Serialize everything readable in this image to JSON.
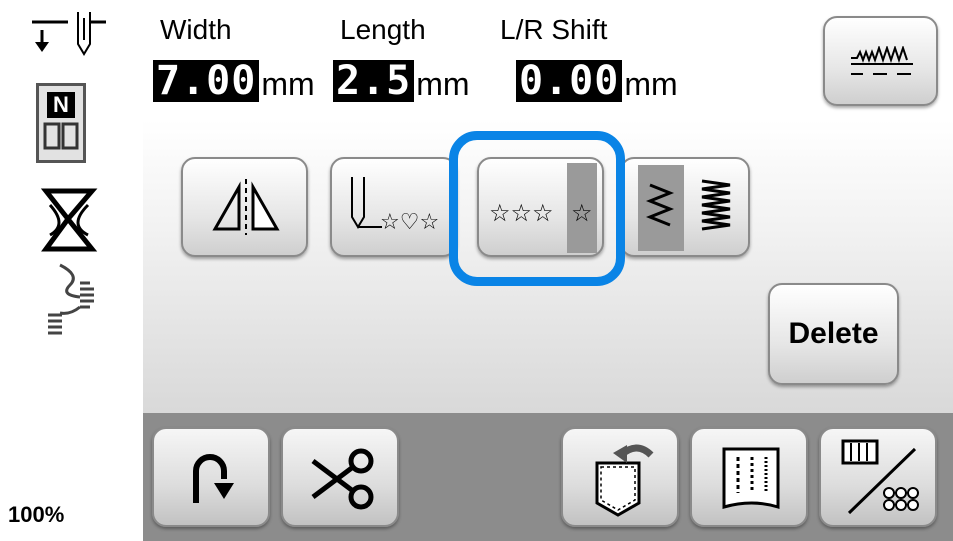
{
  "readouts": {
    "width": {
      "label": "Width",
      "value": "7.00",
      "unit": "mm"
    },
    "length": {
      "label": "Length",
      "value": "2.5",
      "unit": "mm"
    },
    "lr_shift": {
      "label": "L/R Shift",
      "value": "0.00",
      "unit": "mm"
    }
  },
  "buttons": {
    "delete_label": "Delete",
    "selected_button": "single-repeat-button"
  },
  "status": {
    "zoom": "100%",
    "presser_foot": "N"
  },
  "colors": {
    "selection_ring": "#0a84e6",
    "bottom_bar": "#8c8c8c"
  },
  "icons": [
    "needle-position-icon",
    "presser-foot-n-icon",
    "bobbin-wind-icon",
    "stitch-preview-icon",
    "mirror-image-icon",
    "needle-stitch-start-icon",
    "single-repeat-icon",
    "elongation-icon",
    "stitch-width-density-icon",
    "back-tack-icon",
    "thread-cutter-icon",
    "pocket-memory-icon",
    "stitch-guide-icon",
    "image-display-icon"
  ]
}
